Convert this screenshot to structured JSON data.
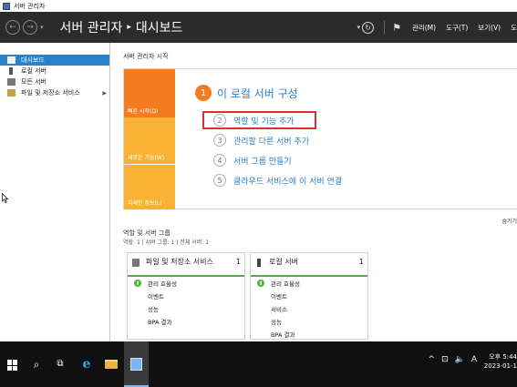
{
  "window": {
    "title": "서버 관리자"
  },
  "header": {
    "back_glyph": "←",
    "forward_glyph": "→",
    "nav_dropdown": "▾",
    "breadcrumb_root": "서버 관리자",
    "breadcrumb_sep": "▸",
    "breadcrumb_current": "대시보드",
    "refresh_dropdown": "▾",
    "refresh_glyph": "↻",
    "flag_glyph": "⚑",
    "menus": [
      "관리(M)",
      "도구(T)",
      "보기(V)",
      "도"
    ]
  },
  "sidebar": {
    "items": [
      {
        "label": "대시보드",
        "icon": "dashboard-icon",
        "active": true
      },
      {
        "label": "로컬 서버",
        "icon": "server-icon"
      },
      {
        "label": "모든 서버",
        "icon": "servers-icon"
      },
      {
        "label": "파일 및 저장소 서비스",
        "icon": "folder-icon",
        "arrow": "▶"
      }
    ]
  },
  "welcome": {
    "section_title": "서버 관리자 시작",
    "tiles": [
      "빠른 시작(Q)",
      "새로운 기능(W)",
      "자세한 정보(L)"
    ],
    "heading_num": "1",
    "heading": "이 로컬 서버 구성",
    "steps": [
      {
        "num": "2",
        "label": "역할 및 기능 추가"
      },
      {
        "num": "3",
        "label": "관리할 다른 서버 추가"
      },
      {
        "num": "4",
        "label": "서버 그룹 만들기"
      },
      {
        "num": "5",
        "label": "클라우드 서비스에 이 서버 연결"
      }
    ],
    "hide_link": "숨기기"
  },
  "roles": {
    "title": "역할 및 서버 그룹",
    "summary": "역할: 1   |   서버 그룹: 1   |   전체 서버: 1",
    "cards": [
      {
        "title": "파일 및 저장소 서비스",
        "count": "1",
        "rows": [
          "관리 효율성",
          "이벤트",
          "성능",
          "BPA 결과"
        ]
      },
      {
        "title": "로컬 서버",
        "count": "1",
        "rows": [
          "관리 효율성",
          "이벤트",
          "서비스",
          "성능",
          "BPA 결과"
        ]
      }
    ],
    "status_glyph": "⬆"
  },
  "taskbar": {
    "search_glyph": "⌕",
    "taskview_glyph": "⧉",
    "ie_glyph": "e",
    "tray": [
      "^",
      "⊡",
      "🔈",
      "A"
    ],
    "time": "오후 5:44",
    "date": "2023-01-1"
  },
  "colors": {
    "accent": "#2c82c9",
    "header_bg": "#2b2b2b",
    "tile_orange": "#f47b20",
    "tile_yellow": "#f9b233",
    "status_green": "#4fb040",
    "highlight_red": "#d93030"
  }
}
